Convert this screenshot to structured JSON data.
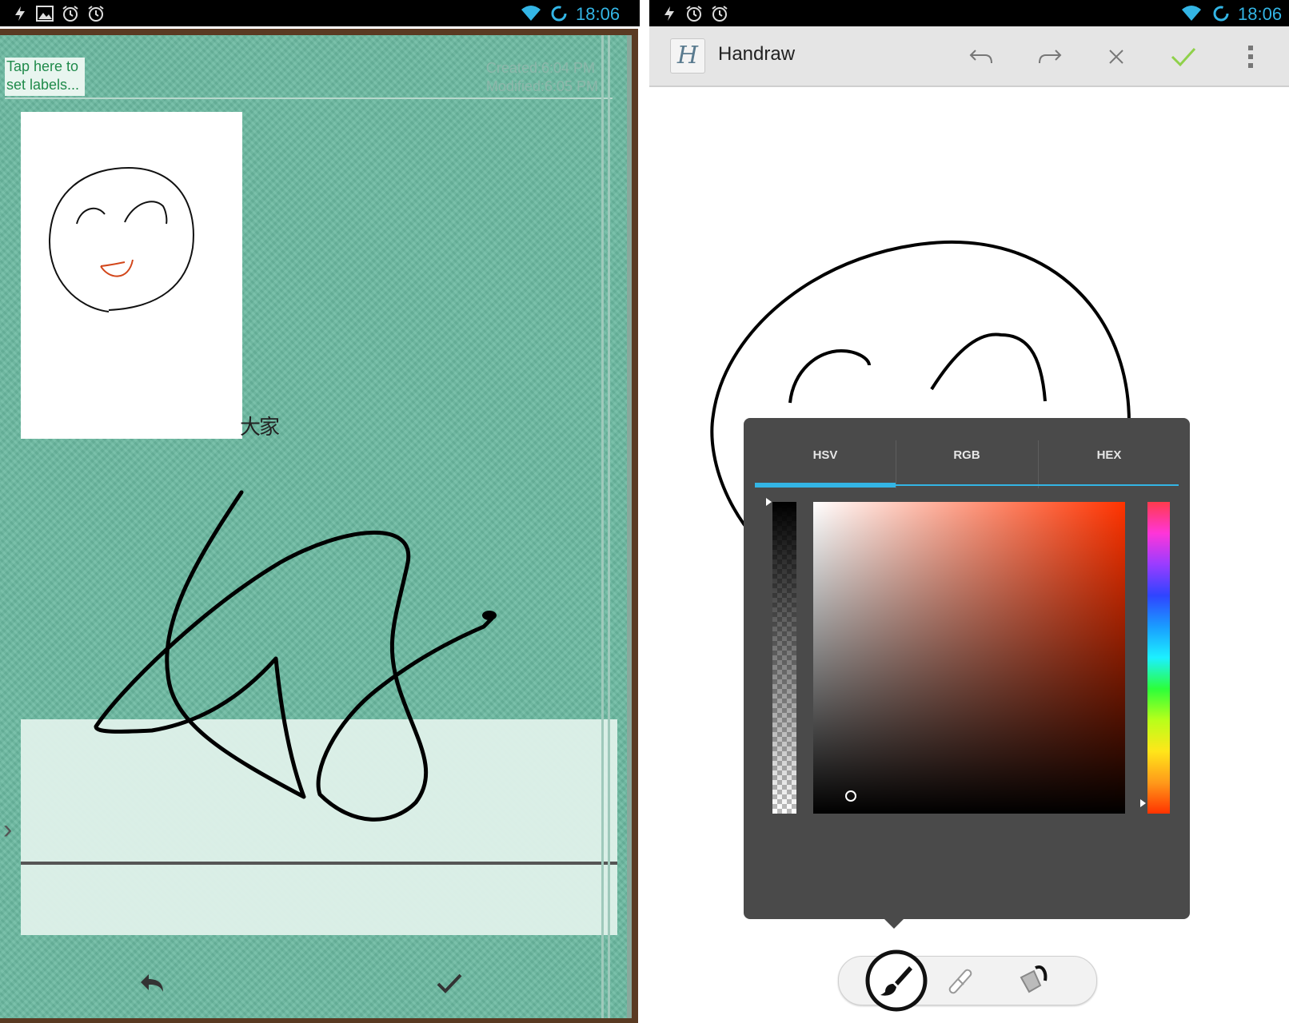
{
  "left": {
    "status_time": "18:06",
    "labels_placeholder": "Tap here to set labels...",
    "created": "Created:6:04 PM",
    "modified": "Modified:6:05 PM",
    "handwriting_text": "大家",
    "icons": [
      "flash-icon",
      "image-icon",
      "alarm-icon",
      "alarm-icon",
      "wifi-icon",
      "sync-icon",
      "back-arrow-icon",
      "checkmark-icon",
      "chevron-right-icon"
    ]
  },
  "right": {
    "status_time": "18:06",
    "app_title": "Handraw",
    "app_icon_letter": "H",
    "actions": [
      "undo-icon",
      "redo-icon",
      "close-icon",
      "check-icon",
      "overflow-menu-icon"
    ],
    "tabs": [
      "HSV",
      "RGB",
      "HEX"
    ],
    "selected_tab": "HSV",
    "colors": {
      "accent": "#33b5e5",
      "hue_selected": "#ff3300",
      "confirm_green": "#8fd14a"
    },
    "tools": [
      "brush-icon",
      "eraser-icon",
      "fill-bucket-icon"
    ],
    "selected_tool": "brush-icon"
  }
}
